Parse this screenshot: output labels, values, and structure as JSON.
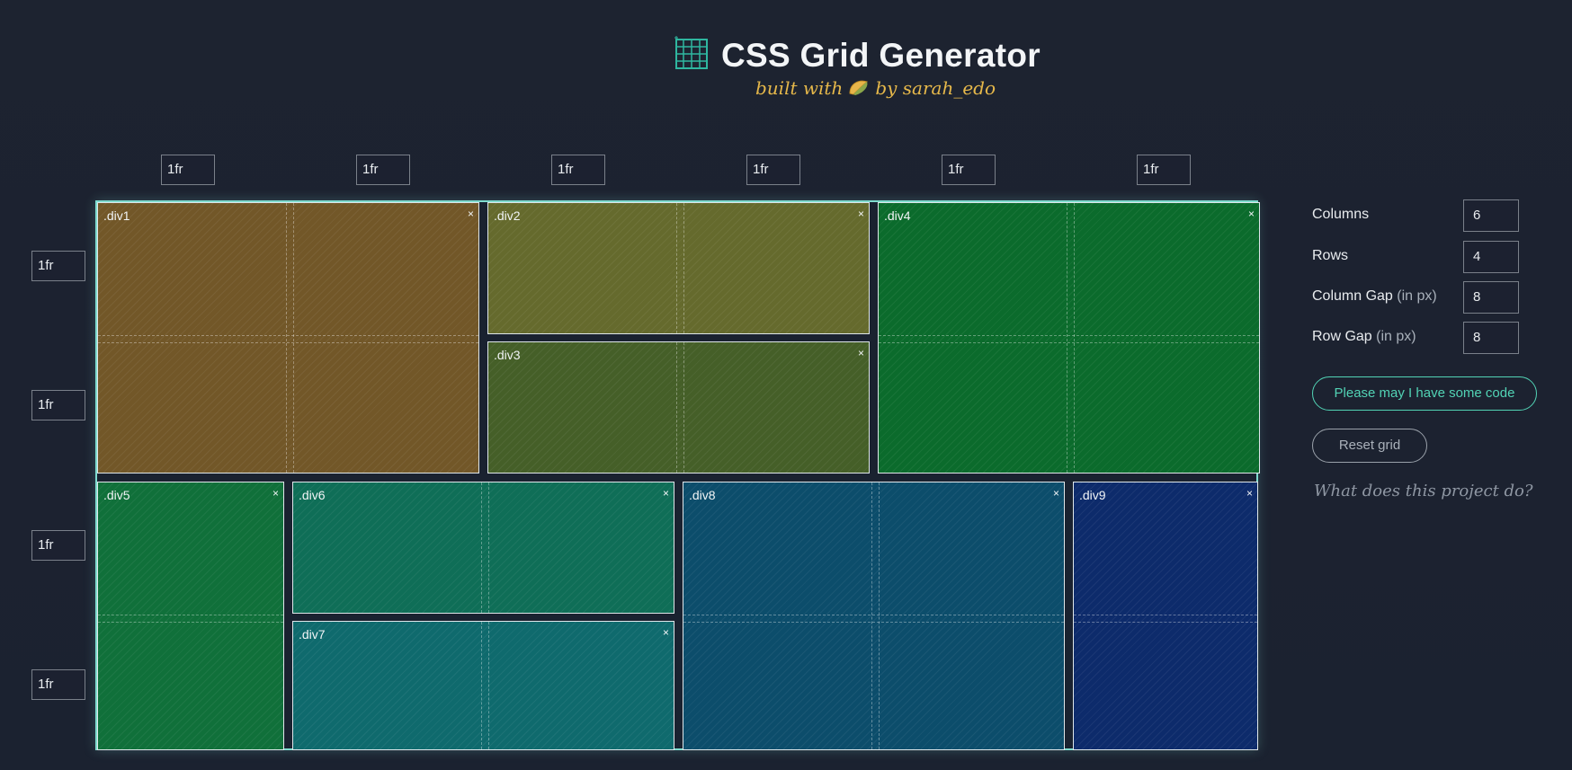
{
  "header": {
    "title": "CSS Grid Generator",
    "subtitle_prefix": "built with",
    "subtitle_suffix": "by sarah_edo",
    "logo_icon": "grid-logo-icon",
    "taco_icon": "taco-icon"
  },
  "columns_inputs": [
    "1fr",
    "1fr",
    "1fr",
    "1fr",
    "1fr",
    "1fr"
  ],
  "rows_inputs": [
    "1fr",
    "1fr",
    "1fr",
    "1fr"
  ],
  "grid_items": [
    {
      "label": ".div1",
      "close": "×",
      "color": "#725728"
    },
    {
      "label": ".div2",
      "close": "×",
      "color": "#656a2d"
    },
    {
      "label": ".div3",
      "close": "×",
      "color": "#455f28"
    },
    {
      "label": ".div4",
      "close": "×",
      "color": "#0b6b2c"
    },
    {
      "label": ".div5",
      "close": "×",
      "color": "#10703a"
    },
    {
      "label": ".div6",
      "close": "×",
      "color": "#0f6e57"
    },
    {
      "label": ".div7",
      "close": "×",
      "color": "#0f6a6d"
    },
    {
      "label": ".div8",
      "close": "×",
      "color": "#0c4d6b"
    },
    {
      "label": ".div9",
      "close": "×",
      "color": "#0d2b6b"
    }
  ],
  "settings": {
    "columns_label": "Columns",
    "columns_value": "6",
    "rows_label": "Rows",
    "rows_value": "4",
    "column_gap_label": "Column Gap",
    "column_gap_hint": "(in px)",
    "column_gap_value": "8",
    "row_gap_label": "Row Gap",
    "row_gap_hint": "(in px)",
    "row_gap_value": "8"
  },
  "buttons": {
    "code": "Please may I have some code",
    "reset": "Reset grid"
  },
  "what_link": "What does this project do?",
  "colors": {
    "accent": "#52d3b5",
    "grid_border": "#7fdccf",
    "subtitle": "#e6b84a",
    "background": "#1d2330"
  }
}
